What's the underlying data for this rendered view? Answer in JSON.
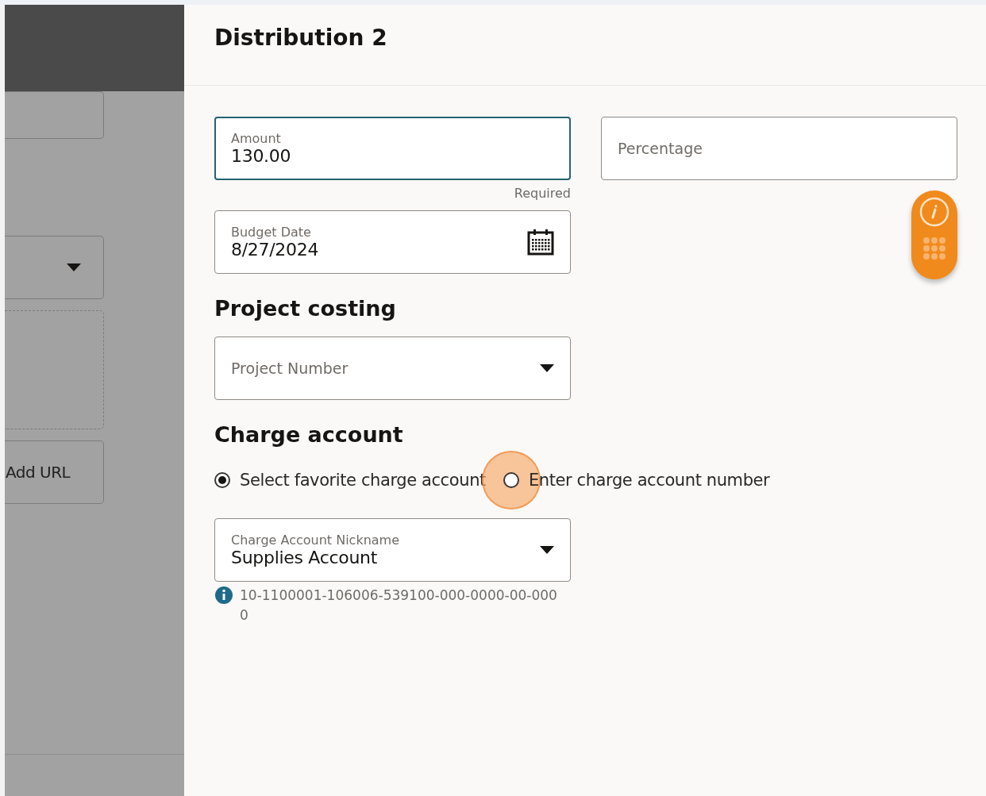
{
  "backdrop": {
    "link_button": "Add URL"
  },
  "panel": {
    "title": "Distribution 2"
  },
  "amount": {
    "label": "Amount",
    "value": "130.00",
    "focused": true,
    "helper": "Required"
  },
  "percentage": {
    "placeholder": "Percentage"
  },
  "budget_date": {
    "label": "Budget Date",
    "value": "8/27/2024"
  },
  "project_costing": {
    "heading": "Project costing",
    "project_number": {
      "placeholder": "Project Number"
    }
  },
  "charge_account": {
    "heading": "Charge account",
    "options": [
      {
        "label": "Select favorite charge account",
        "selected": true,
        "highlighted": false
      },
      {
        "label": "Enter charge account number",
        "selected": false,
        "highlighted": true
      }
    ],
    "nickname": {
      "label": "Charge Account Nickname",
      "value": "Supplies Account"
    },
    "account_number": "10-1100001-106006-539100-000-0000-00-0000"
  }
}
